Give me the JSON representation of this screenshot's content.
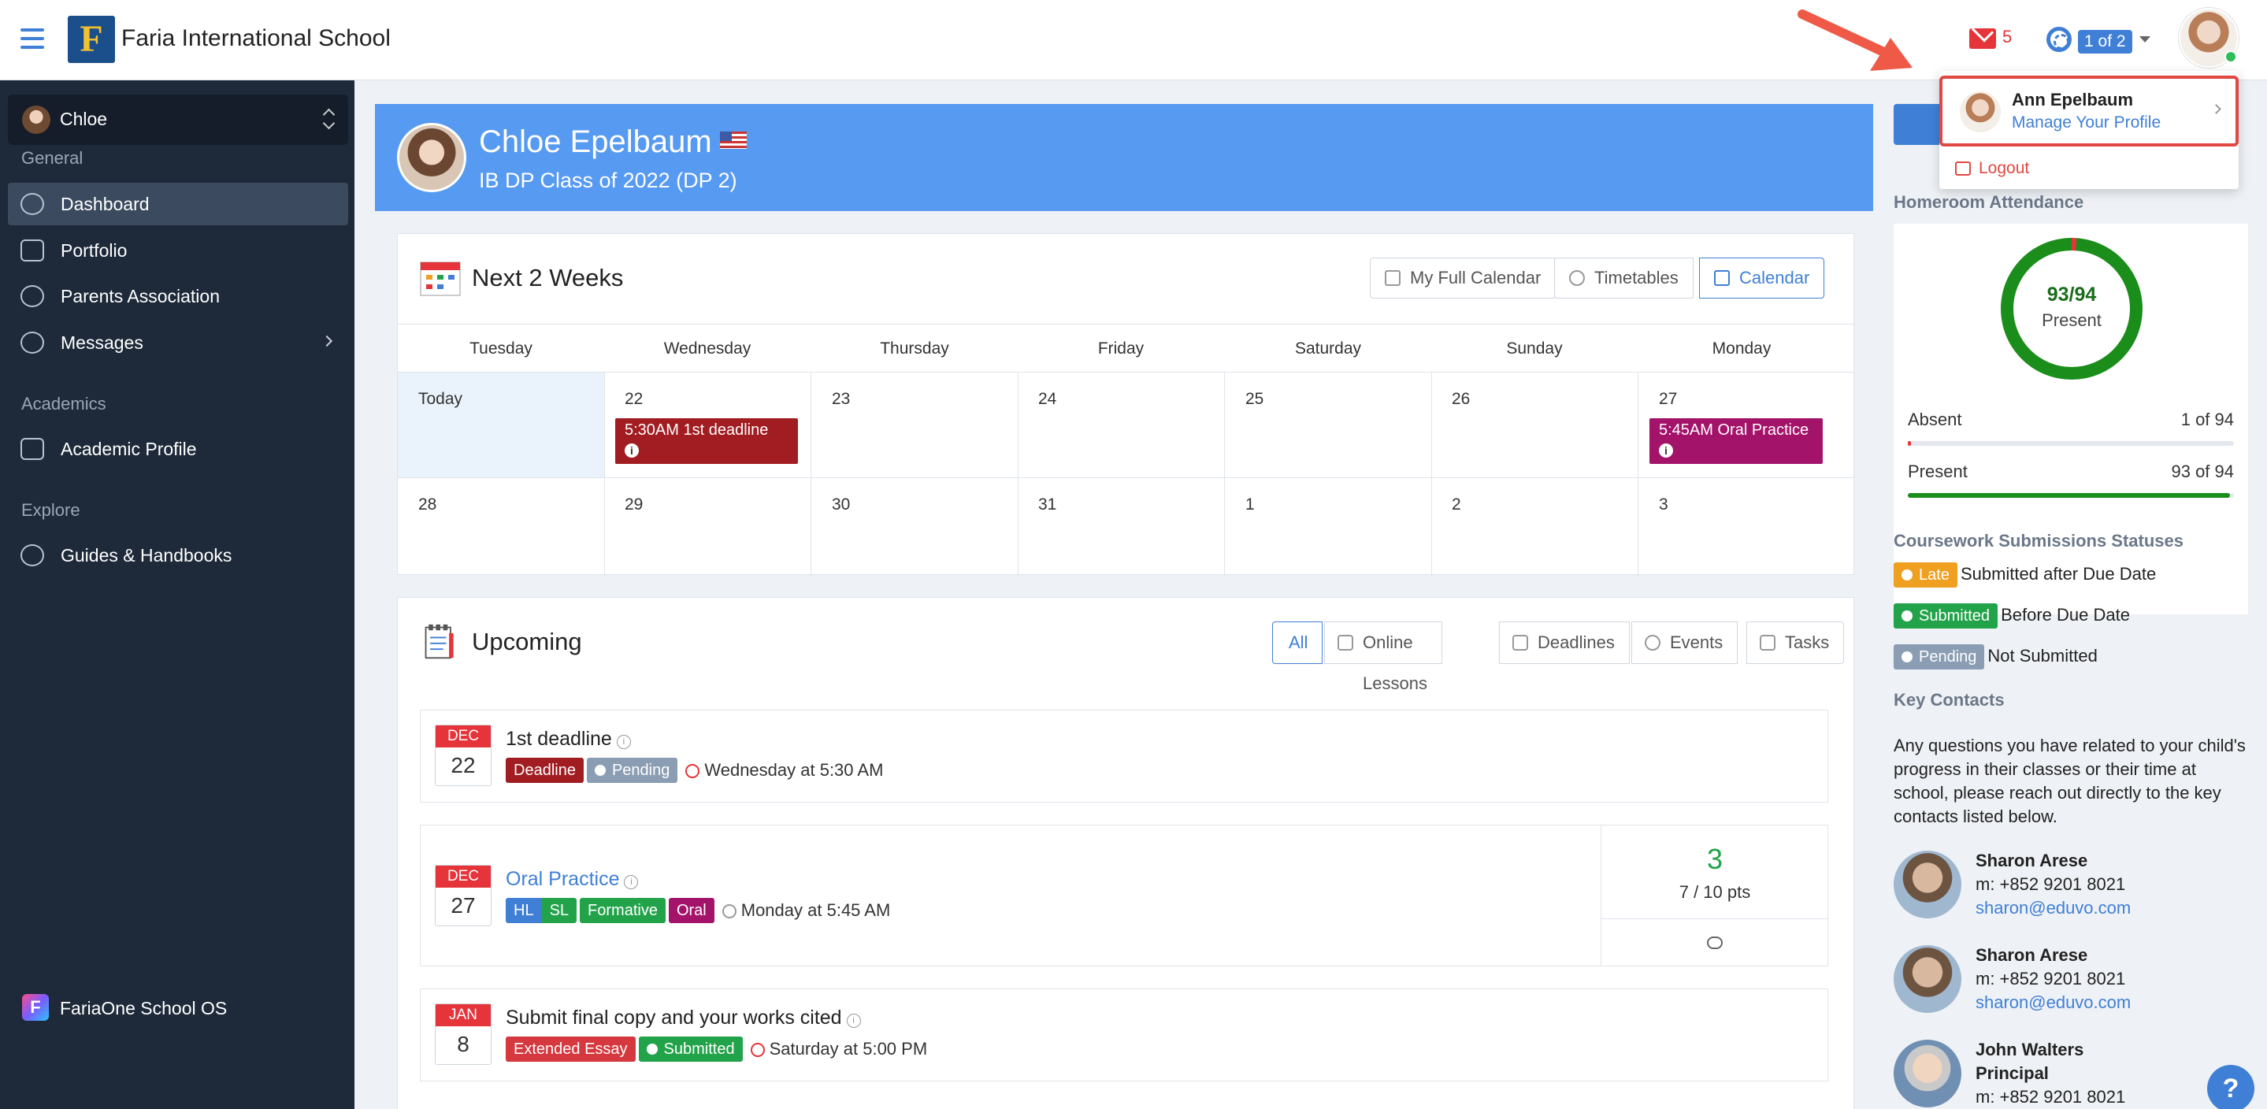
{
  "topbar": {
    "school_name": "Faria International School",
    "logo_letter": "F",
    "mail_count": "5",
    "pager": "1 of 2"
  },
  "sidebar": {
    "student": "Chloe",
    "sections": {
      "general": "General",
      "academics": "Academics",
      "explore": "Explore"
    },
    "items": [
      {
        "label": "Dashboard",
        "icon": "dashboard-icon"
      },
      {
        "label": "Portfolio",
        "icon": "briefcase-icon"
      },
      {
        "label": "Parents Association",
        "icon": "people-icon"
      },
      {
        "label": "Messages",
        "icon": "chat-icon"
      },
      {
        "label": "Academic Profile",
        "icon": "document-icon"
      },
      {
        "label": "Guides & Handbooks",
        "icon": "sitemap-icon"
      }
    ],
    "footer": "FariaOne School OS",
    "footer_letter": "F"
  },
  "header": {
    "name": "Chloe Epelbaum",
    "class": "IB DP Class of 2022 (DP 2)"
  },
  "calendar": {
    "title": "Next 2 Weeks",
    "buttons": {
      "full": "My Full Calendar",
      "timetables": "Timetables",
      "calendar": "Calendar"
    },
    "days": [
      "Tuesday",
      "Wednesday",
      "Thursday",
      "Friday",
      "Saturday",
      "Sunday",
      "Monday"
    ],
    "week1": [
      "Today",
      "22",
      "23",
      "24",
      "25",
      "26",
      "27"
    ],
    "week2": [
      "28",
      "29",
      "30",
      "31",
      "1",
      "2",
      "3"
    ],
    "events": {
      "wed": "5:30AM 1st deadline",
      "mon": "5:45AM Oral Practice"
    },
    "info_glyph": "i"
  },
  "upcoming": {
    "title": "Upcoming",
    "tabs": [
      "All",
      "Online Lessons",
      "Deadlines",
      "Events",
      "Tasks"
    ],
    "items": [
      {
        "month": "DEC",
        "day": "22",
        "title": "1st deadline",
        "badges": [
          "Deadline",
          "Pending"
        ],
        "when": "Wednesday at 5:30 AM"
      },
      {
        "month": "DEC",
        "day": "27",
        "title": "Oral Practice",
        "badges": [
          "HL",
          "SL",
          "Formative",
          "Oral"
        ],
        "when": "Monday at 5:45 AM",
        "score": "3",
        "points": "7 / 10 pts"
      },
      {
        "month": "JAN",
        "day": "8",
        "title": "Submit final copy and your works cited",
        "badges": [
          "Extended Essay",
          "Submitted"
        ],
        "when": "Saturday at 5:00 PM"
      }
    ],
    "question_glyph": "i"
  },
  "right": {
    "attendance_title": "Homeroom Attendance",
    "attendance_value": "93/94",
    "attendance_label": "Present",
    "absent_label": "Absent",
    "absent_value": "1 of 94",
    "present_label": "Present",
    "present_value": "93 of 94",
    "absent_fraction": 0.0106,
    "present_fraction": 0.989,
    "statuses_title": "Coursework Submissions Statuses",
    "statuses": [
      {
        "badge": "Late",
        "text": "Submitted after Due Date",
        "color": "#f0a020"
      },
      {
        "badge": "Submitted",
        "text": "Before Due Date",
        "color": "#22a34a"
      },
      {
        "badge": "Pending",
        "text": "Not Submitted",
        "color": "#8a9db3"
      }
    ],
    "contacts_title": "Key Contacts",
    "contacts_text": "Any questions you have related to your child's progress in their classes or their time at school, please reach out directly to the key contacts listed below.",
    "contacts": [
      {
        "name": "Sharon Arese",
        "phone": "m: +852 9201 8021",
        "email": "sharon@eduvo.com"
      },
      {
        "name": "Sharon Arese",
        "phone": "m: +852 9201 8021",
        "email": "sharon@eduvo.com"
      },
      {
        "name": "John Walters",
        "role": "Principal",
        "phone": "m: +852 9201 8021"
      }
    ],
    "help_glyph": "?"
  },
  "dropdown": {
    "name": "Ann Epelbaum",
    "link": "Manage Your Profile",
    "logout": "Logout"
  },
  "colors": {
    "accent": "#3f7fd6",
    "sidebar": "#1e2a3a",
    "header_card": "#579af2",
    "deadline": "#a11d22",
    "oral": "#a3136a",
    "danger": "#e5343a",
    "success": "#22a34a"
  }
}
